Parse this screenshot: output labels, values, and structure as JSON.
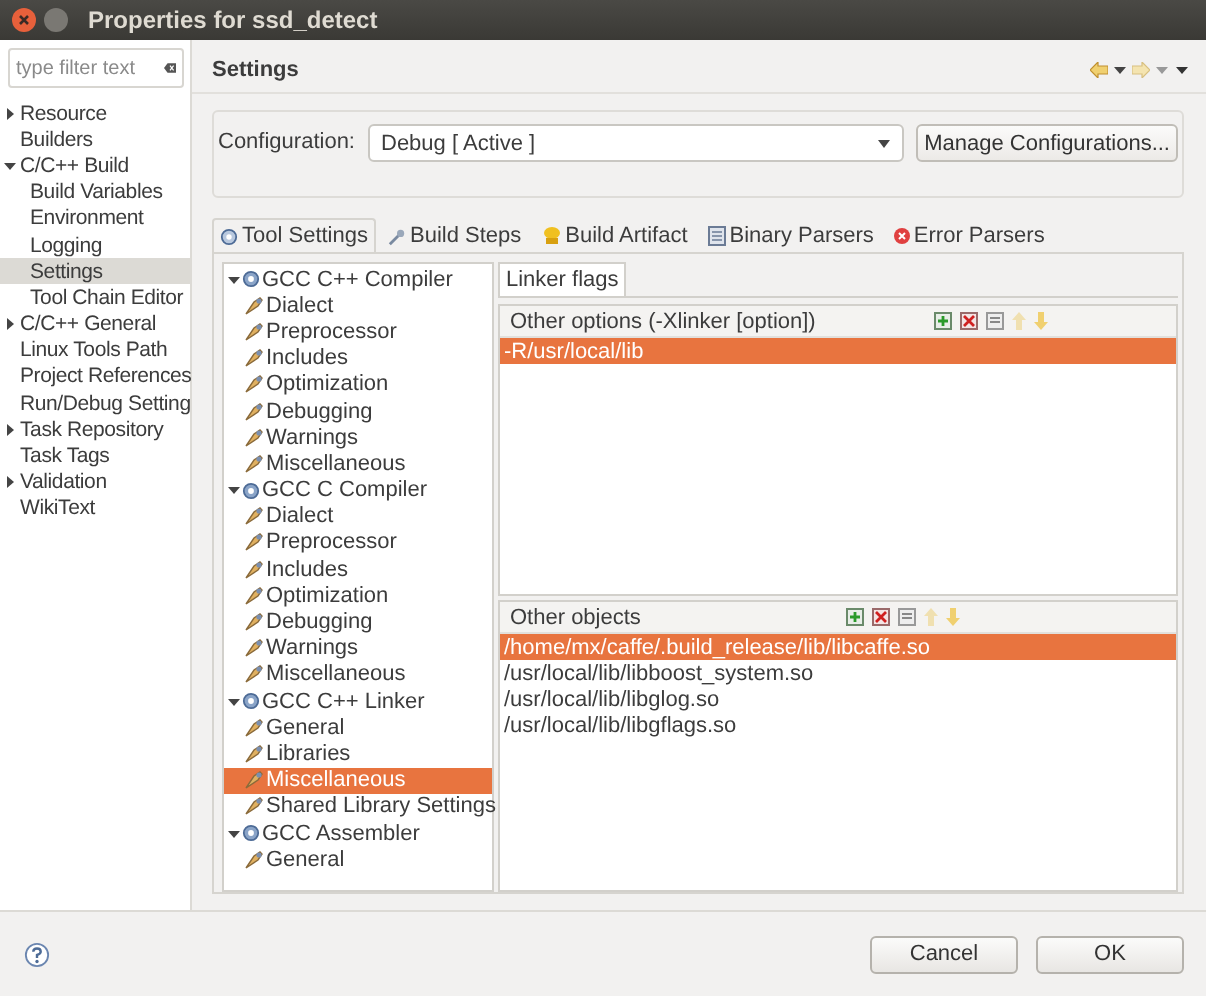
{
  "window": {
    "title": "Properties for ssd_detect"
  },
  "sidebar": {
    "filter": {
      "placeholder": "type filter text"
    },
    "items": [
      {
        "label": "Resource",
        "expanded": false,
        "selected": false
      },
      {
        "label": "Builders",
        "selected": false
      },
      {
        "label": "C/C++ Build",
        "expanded": true,
        "selected": false,
        "children": [
          {
            "label": "Build Variables",
            "selected": false
          },
          {
            "label": "Environment",
            "selected": false
          },
          {
            "label": "Logging",
            "selected": false
          },
          {
            "label": "Settings",
            "selected": true
          },
          {
            "label": "Tool Chain Editor",
            "selected": false
          }
        ]
      },
      {
        "label": "C/C++ General",
        "expanded": false,
        "selected": false
      },
      {
        "label": "Linux Tools Path",
        "selected": false
      },
      {
        "label": "Project References",
        "selected": false
      },
      {
        "label": "Run/Debug Setting",
        "selected": false
      },
      {
        "label": "Task Repository",
        "expanded": false,
        "selected": false
      },
      {
        "label": "Task Tags",
        "selected": false
      },
      {
        "label": "Validation",
        "expanded": false,
        "selected": false
      },
      {
        "label": "WikiText",
        "selected": false
      }
    ]
  },
  "page": {
    "title": "Settings",
    "configuration": {
      "label": "Configuration:",
      "value": "Debug  [ Active ]"
    },
    "manage_button": "Manage Configurations...",
    "tabs": [
      {
        "label": "Tool Settings",
        "selected": true
      },
      {
        "label": "Build Steps",
        "selected": false
      },
      {
        "label": "Build Artifact",
        "selected": false
      },
      {
        "label": "Binary Parsers",
        "selected": false
      },
      {
        "label": "Error Parsers",
        "selected": false
      }
    ],
    "tool_tree": [
      {
        "label": "GCC C++ Compiler",
        "expanded": true,
        "selected": false,
        "children": [
          {
            "label": "Dialect",
            "selected": false
          },
          {
            "label": "Preprocessor",
            "selected": false
          },
          {
            "label": "Includes",
            "selected": false
          },
          {
            "label": "Optimization",
            "selected": false
          },
          {
            "label": "Debugging",
            "selected": false
          },
          {
            "label": "Warnings",
            "selected": false
          },
          {
            "label": "Miscellaneous",
            "selected": false
          }
        ]
      },
      {
        "label": "GCC C Compiler",
        "expanded": true,
        "selected": false,
        "children": [
          {
            "label": "Dialect",
            "selected": false
          },
          {
            "label": "Preprocessor",
            "selected": false
          },
          {
            "label": "Includes",
            "selected": false
          },
          {
            "label": "Optimization",
            "selected": false
          },
          {
            "label": "Debugging",
            "selected": false
          },
          {
            "label": "Warnings",
            "selected": false
          },
          {
            "label": "Miscellaneous",
            "selected": false
          }
        ]
      },
      {
        "label": "GCC C++ Linker",
        "expanded": true,
        "selected": false,
        "children": [
          {
            "label": "General",
            "selected": false
          },
          {
            "label": "Libraries",
            "selected": false
          },
          {
            "label": "Miscellaneous",
            "selected": true
          },
          {
            "label": "Shared Library Settings",
            "selected": false
          }
        ]
      },
      {
        "label": "GCC Assembler",
        "expanded": true,
        "selected": false,
        "children": [
          {
            "label": "General",
            "selected": false
          }
        ]
      }
    ],
    "linker_flags": {
      "label": "Linker flags"
    },
    "lists": [
      {
        "title": "Other options (-Xlinker [option])",
        "items": [
          {
            "text": "-R/usr/local/lib",
            "selected": true
          }
        ]
      },
      {
        "title": "Other objects",
        "items": [
          {
            "text": "/home/mx/caffe/.build_release/lib/libcaffe.so",
            "selected": true
          },
          {
            "text": "/usr/local/lib/libboost_system.so",
            "selected": false
          },
          {
            "text": "/usr/local/lib/libglog.so",
            "selected": false
          },
          {
            "text": "/usr/local/lib/libgflags.so",
            "selected": false
          }
        ]
      }
    ]
  },
  "buttons": [
    "Cancel",
    "OK"
  ]
}
